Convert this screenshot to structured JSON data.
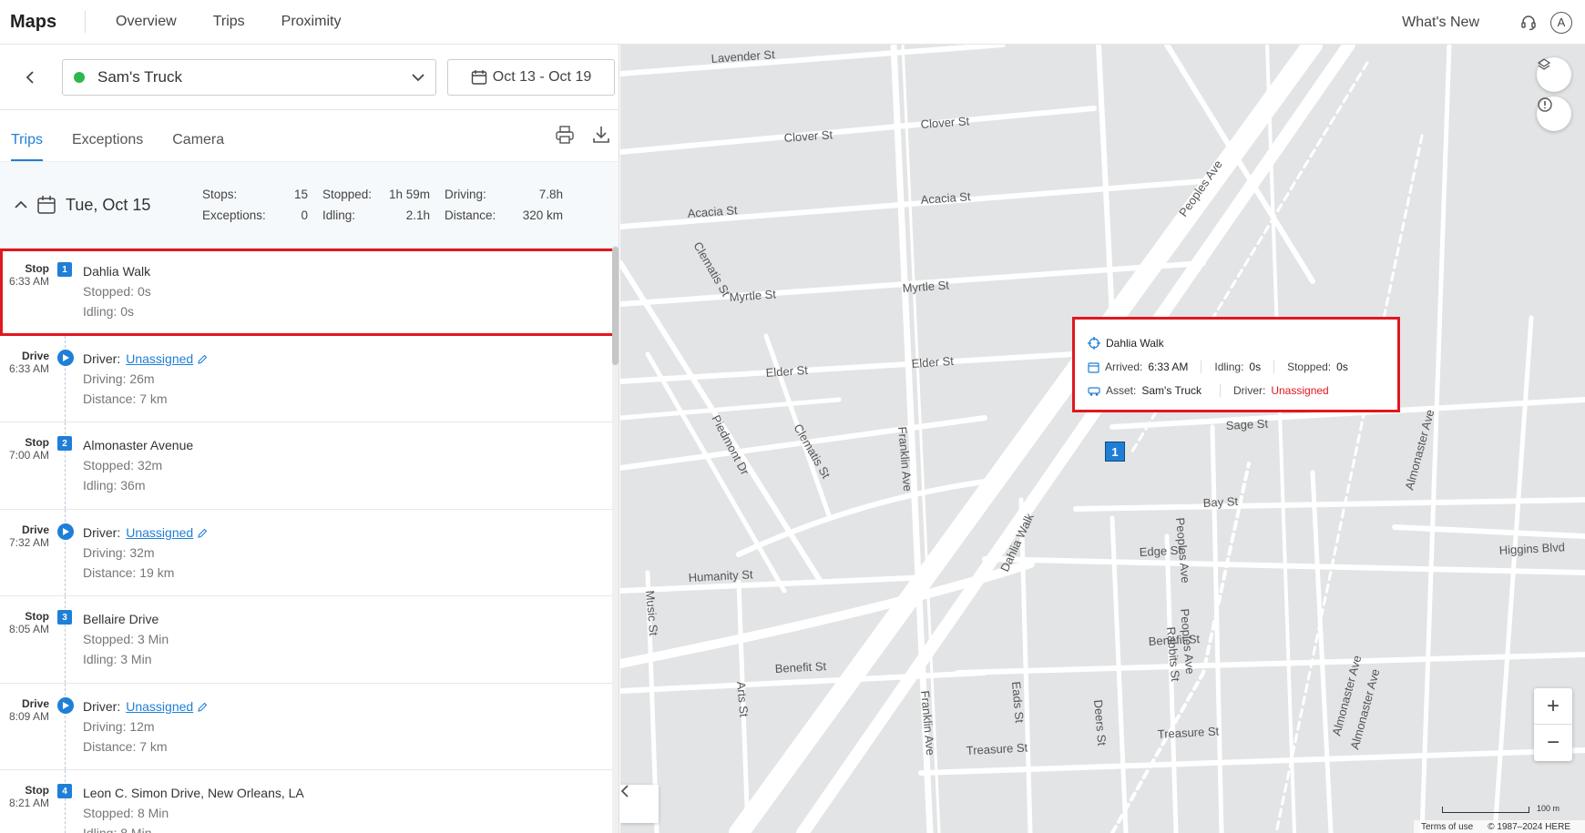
{
  "app": {
    "title": "Maps",
    "nav": [
      "Overview",
      "Trips",
      "Proximity"
    ],
    "whats_new": "What's New",
    "avatar_initial": "A"
  },
  "selector": {
    "vehicle": "Sam's Truck",
    "vehicle_status_color": "#2db84b",
    "date_range": "Oct 13 - Oct 19"
  },
  "tabs": [
    "Trips",
    "Exceptions",
    "Camera"
  ],
  "active_tab": "Trips",
  "day": {
    "title": "Tue, Oct 15",
    "stats": {
      "stops_label": "Stops:",
      "stops": "15",
      "stopped_label": "Stopped:",
      "stopped": "1h 59m",
      "driving_label": "Driving:",
      "driving": "7.8h",
      "exceptions_label": "Exceptions:",
      "exceptions": "0",
      "idling_label": "Idling:",
      "idling": "2.1h",
      "distance_label": "Distance:",
      "distance": "320 km"
    }
  },
  "entries": [
    {
      "type": "Stop",
      "time": "6:33 AM",
      "badge": "1",
      "title": "Dahlia Walk",
      "line2": "Stopped: 0s",
      "line3": "Idling: 0s"
    },
    {
      "type": "Drive",
      "time": "6:33 AM",
      "driver_label": "Driver:",
      "driver": "Unassigned",
      "line2": "Driving: 26m",
      "line3": "Distance: 7 km"
    },
    {
      "type": "Stop",
      "time": "7:00 AM",
      "badge": "2",
      "title": "Almonaster Avenue",
      "line2": "Stopped: 32m",
      "line3": "Idling: 36m"
    },
    {
      "type": "Drive",
      "time": "7:32 AM",
      "driver_label": "Driver:",
      "driver": "Unassigned",
      "line2": "Driving: 32m",
      "line3": "Distance: 19 km"
    },
    {
      "type": "Stop",
      "time": "8:05 AM",
      "badge": "3",
      "title": "Bellaire Drive",
      "line2": "Stopped: 3 Min",
      "line3": "Idling: 3 Min"
    },
    {
      "type": "Drive",
      "time": "8:09 AM",
      "driver_label": "Driver:",
      "driver": "Unassigned",
      "line2": "Driving: 12m",
      "line3": "Distance: 7 km"
    },
    {
      "type": "Stop",
      "time": "8:21 AM",
      "badge": "4",
      "title": "Leon C. Simon Drive, New Orleans, LA",
      "line2": "Stopped: 8 Min",
      "line3": "Idling: 8 Min"
    }
  ],
  "map": {
    "pin_label": "1",
    "popup": {
      "place": "Dahlia Walk",
      "arrived_label": "Arrived:",
      "arrived": "6:33 AM",
      "idling_label": "Idling:",
      "idling": "0s",
      "stopped_label": "Stopped:",
      "stopped": "0s",
      "asset_label": "Asset:",
      "asset": "Sam's Truck",
      "driver_label": "Driver:",
      "driver": "Unassigned"
    },
    "streets": [
      "Lavender St",
      "Clover St",
      "Acacia St",
      "Myrtle St",
      "Elder St",
      "Sage St",
      "Bay St",
      "Edge St",
      "Benefit St",
      "Treasure St",
      "Humanity St",
      "Franklin Ave",
      "Clematis St",
      "Piedmont Dr",
      "Peoples Ave",
      "Almonaster Ave",
      "Dahlia Walk",
      "Higgins Blvd",
      "Music St",
      "Arts St",
      "Eads St",
      "Deers St",
      "Rabbits St"
    ],
    "scale": "100 m",
    "terms": "Terms of use",
    "copyright": "© 1987–2024 HERE",
    "zoom_in": "+",
    "zoom_out": "−"
  }
}
